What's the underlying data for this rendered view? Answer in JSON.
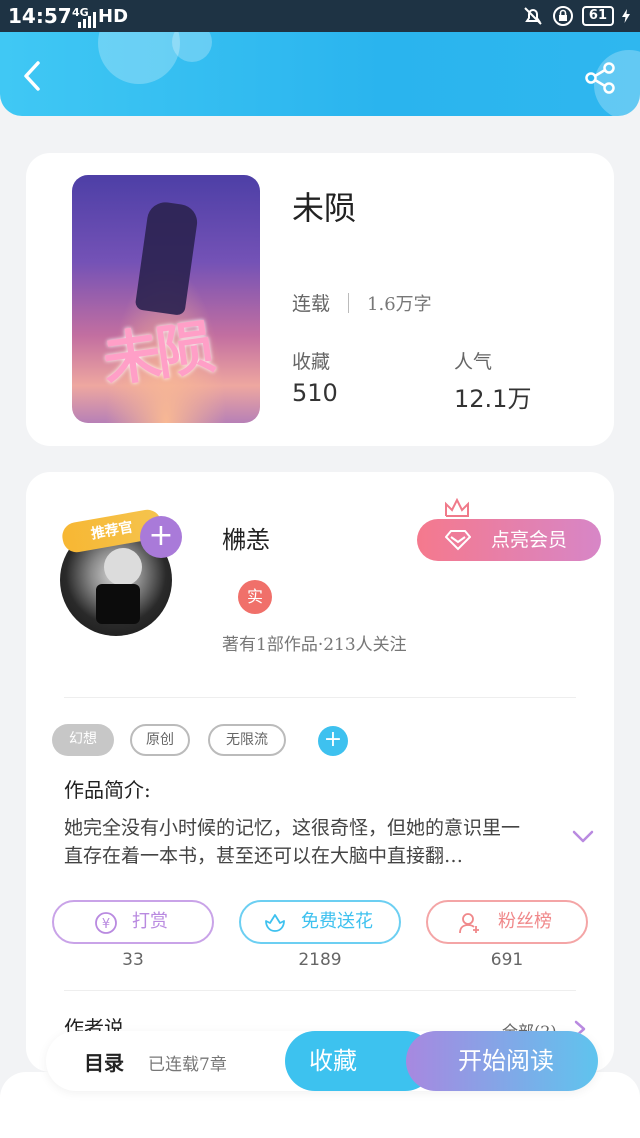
{
  "status_bar": {
    "time": "14:57",
    "network": "4G",
    "hd": "HD",
    "battery": "61"
  },
  "header": {
    "back_icon": "back-arrow-icon",
    "share_icon": "share-icon",
    "color": "#2ab4ee"
  },
  "book": {
    "title": "未陨",
    "cover_title": "未陨",
    "status": "连载",
    "word_count": "1.6万字",
    "collect_label": "收藏",
    "collect_value": "510",
    "popularity_label": "人气",
    "popularity_value": "12.1万"
  },
  "author": {
    "name": "梻恙",
    "recommend_badge": "推荐官",
    "verified_badge": "实",
    "stats": "著有1部作品·213人关注",
    "member_button": "点亮会员"
  },
  "tags": [
    "幻想",
    "原创",
    "无限流"
  ],
  "synopsis": {
    "title": "作品简介:",
    "text": "她完全没有小时候的记忆，这很奇怪，但她的意识里一直存在着一本书，甚至还可以在大脑中直接翻…"
  },
  "actions": [
    {
      "label": "打赏",
      "count": "33",
      "icon": "yuan-icon",
      "color": "#b98ae0"
    },
    {
      "label": "免费送花",
      "count": "2189",
      "icon": "flower-icon",
      "color": "#3ec1ef"
    },
    {
      "label": "粉丝榜",
      "count": "691",
      "icon": "fans-icon",
      "color": "#f0888a"
    }
  ],
  "author_says": {
    "title": "作者说",
    "all_link": "全部(2)"
  },
  "bottom_bar": {
    "toc": "目录",
    "chapters": "已连载7章",
    "collect_button": "收藏",
    "read_button": "开始阅读"
  }
}
